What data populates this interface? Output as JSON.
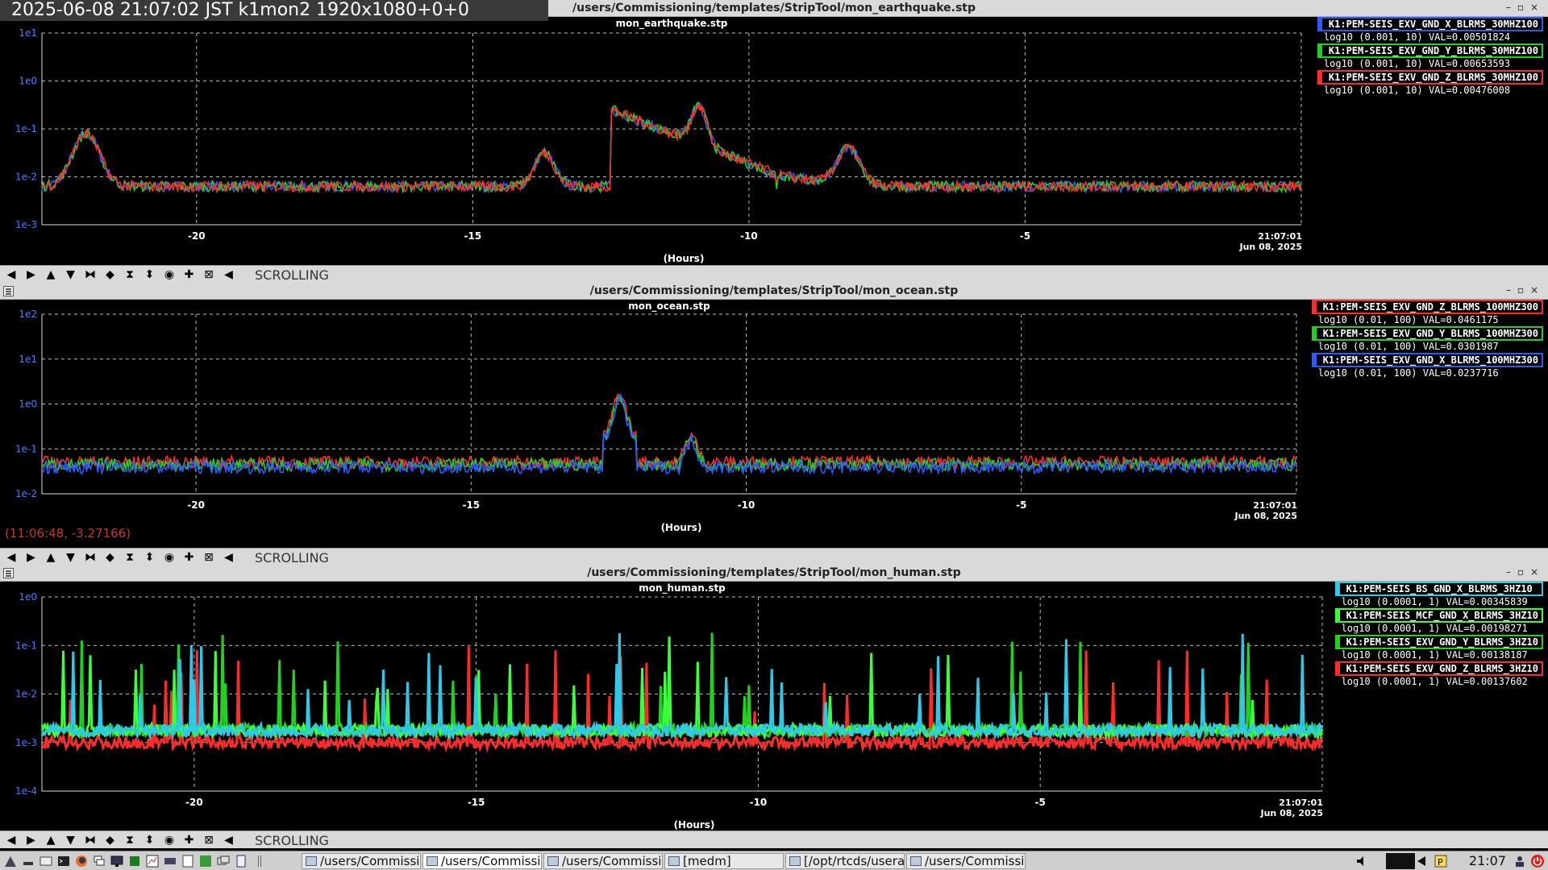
{
  "overlay": {
    "clock_text": "2025-06-08 21:07:02 JST k1mon2 1920x1080+0+0"
  },
  "colors": {
    "blue": "#2a5bff",
    "green": "#22d022",
    "red": "#ff2a2a",
    "cyan": "#2ec8e8",
    "lime": "#3bff3b",
    "grid": "#bbbbbb",
    "ytick": "#4a7dff"
  },
  "windows": [
    {
      "title": "/users/Commissioning/templates/StripTool/mon_earthquake.stp",
      "plot_title": "mon_earthquake.stp",
      "y_ticks": [
        "1e1",
        "1e0",
        "1e-1",
        "1e-2",
        "1e-3"
      ],
      "x_ticks": [
        "-20",
        "-15",
        "-10",
        "-5"
      ],
      "x_unit": "(Hours)",
      "end_time": "21:07:01",
      "end_date": "Jun 08, 2025",
      "legend": [
        {
          "name": "K1:PEM-SEIS_EXV_GND_X_BLRMS_30MHZ100",
          "range": "log10 (0.001, 10) VAL=0.00501824",
          "color": "#2a5bff"
        },
        {
          "name": "K1:PEM-SEIS_EXV_GND_Y_BLRMS_30MHZ100",
          "range": "log10 (0.001, 10) VAL=0.00653593",
          "color": "#22d022"
        },
        {
          "name": "K1:PEM-SEIS_EXV_GND_Z_BLRMS_30MHZ100",
          "range": "log10 (0.001, 10) VAL=0.00476008",
          "color": "#ff2a2a"
        }
      ]
    },
    {
      "title": "/users/Commissioning/templates/StripTool/mon_ocean.stp",
      "plot_title": "mon_ocean.stp",
      "y_ticks": [
        "1e2",
        "1e1",
        "1e0",
        "1e-1",
        "1e-2"
      ],
      "x_ticks": [
        "-20",
        "-15",
        "-10",
        "-5"
      ],
      "x_unit": "(Hours)",
      "end_time": "21:07:01",
      "end_date": "Jun 08, 2025",
      "coord_readout": "(11:06:48, -3.27166)",
      "legend": [
        {
          "name": "K1:PEM-SEIS_EXV_GND_Z_BLRMS_100MHZ300",
          "range": "log10 (0.01, 100) VAL=0.0461175",
          "color": "#ff2a2a"
        },
        {
          "name": "K1:PEM-SEIS_EXV_GND_Y_BLRMS_100MHZ300",
          "range": "log10 (0.01, 100) VAL=0.0301987",
          "color": "#22d022"
        },
        {
          "name": "K1:PEM-SEIS_EXV_GND_X_BLRMS_100MHZ300",
          "range": "log10 (0.01, 100) VAL=0.0237716",
          "color": "#2a5bff"
        }
      ]
    },
    {
      "title": "/users/Commissioning/templates/StripTool/mon_human.stp",
      "plot_title": "mon_human.stp",
      "y_ticks": [
        "1e0",
        "1e-1",
        "1e-2",
        "1e-3",
        "1e-4"
      ],
      "x_ticks": [
        "-20",
        "-15",
        "-10",
        "-5"
      ],
      "x_unit": "(Hours)",
      "end_time": "21:07:01",
      "end_date": "Jun 08, 2025",
      "legend": [
        {
          "name": "K1:PEM-SEIS_BS_GND_X_BLRMS_3HZ10",
          "range": "log10 (0.0001, 1) VAL=0.00345839",
          "color": "#2ec8e8"
        },
        {
          "name": "K1:PEM-SEIS_MCF_GND_X_BLRMS_3HZ10",
          "range": "log10 (0.0001, 1) VAL=0.00198271",
          "color": "#3bff3b"
        },
        {
          "name": "K1:PEM-SEIS_EXV_GND_Y_BLRMS_3HZ10",
          "range": "log10 (0.0001, 1) VAL=0.00138187",
          "color": "#22d022"
        },
        {
          "name": "K1:PEM-SEIS_EXV_GND_Z_BLRMS_3HZ10",
          "range": "log10 (0.0001, 1) VAL=0.00137602",
          "color": "#ff2a2a"
        }
      ]
    }
  ],
  "toolbar": {
    "mode_label": "SCROLLING",
    "buttons": [
      "arrow-left-icon",
      "arrow-right-icon",
      "arrow-up-icon",
      "arrow-down-icon",
      "zoom-x-in-icon",
      "zoom-x-out-icon",
      "zoom-y-in-icon",
      "zoom-y-out-icon",
      "refresh-icon",
      "crosshair-icon",
      "autoscale-icon",
      "pause-icon"
    ]
  },
  "taskbar": {
    "tasks": [
      {
        "label": "/users/Commissi...",
        "active": false
      },
      {
        "label": "/users/Commissi...",
        "active": true
      },
      {
        "label": "/users/Commissi...",
        "active": false
      },
      {
        "label": "[medm]",
        "active": false
      },
      {
        "label": "[/opt/rtcds/usera...",
        "active": false
      },
      {
        "label": "/users/Commissi...",
        "active": false
      }
    ],
    "clock": "21:07"
  }
}
